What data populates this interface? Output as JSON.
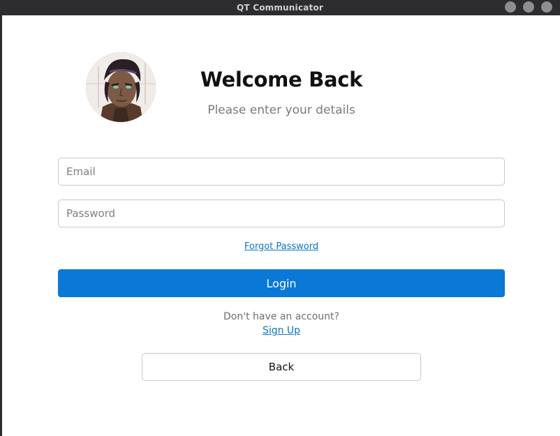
{
  "window": {
    "title": "QT Communicator",
    "controls": [
      "minimize",
      "maximize",
      "close"
    ]
  },
  "header": {
    "title": "Welcome Back",
    "subtitle": "Please enter your details"
  },
  "avatar": {
    "icon": "user-avatar-icon"
  },
  "form": {
    "email": {
      "value": "",
      "placeholder": "Email"
    },
    "password": {
      "value": "",
      "placeholder": "Password"
    },
    "forgot_password_label": "Forgot Password",
    "login_label": "Login"
  },
  "footer": {
    "no_account_text": "Don't have an account?",
    "signup_label": "Sign Up",
    "back_label": "Back"
  },
  "colors": {
    "accent": "#0a78d7",
    "link": "#0a74c9",
    "titlebar": "#2d2d30"
  }
}
